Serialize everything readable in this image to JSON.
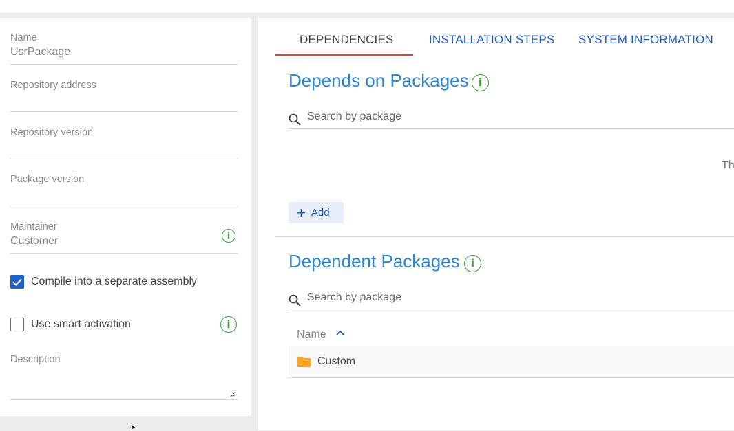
{
  "left_panel": {
    "name": {
      "label": "Name",
      "value": "UsrPackage"
    },
    "repository_address": {
      "label": "Repository address",
      "value": ""
    },
    "repository_version": {
      "label": "Repository version",
      "value": ""
    },
    "package_version": {
      "label": "Package version",
      "value": ""
    },
    "maintainer": {
      "label": "Maintainer",
      "value": "Customer"
    },
    "compile_separate": {
      "label": "Compile into a separate assembly",
      "checked": true
    },
    "smart_activation": {
      "label": "Use smart activation",
      "checked": false
    },
    "description": {
      "label": "Description",
      "value": ""
    }
  },
  "tabs": [
    {
      "label": "DEPENDENCIES",
      "active": true
    },
    {
      "label": "INSTALLATION STEPS",
      "active": false
    },
    {
      "label": "SYSTEM INFORMATION",
      "active": false
    }
  ],
  "depends_on": {
    "title": "Depends on Packages",
    "search_placeholder": "Search by package",
    "empty_text": "Th",
    "add_label": "Add"
  },
  "dependent": {
    "title": "Dependent Packages",
    "search_placeholder": "Search by package",
    "column_name": "Name",
    "rows": [
      {
        "name": "Custom",
        "icon": "folder-icon"
      }
    ]
  },
  "colors": {
    "accent_blue": "#1f5fc2",
    "title_blue": "#2d86d2",
    "info_green": "#38a33a",
    "tab_underline_red": "#e2413a",
    "folder_orange": "#f5a623"
  },
  "icons": {
    "info": "info-icon",
    "search": "search-icon",
    "add": "plus-icon",
    "sort": "chevron-up-icon",
    "folder": "folder-icon",
    "check": "checkmark-icon",
    "resize": "resize-handle-icon",
    "cursor": "mouse-cursor"
  }
}
